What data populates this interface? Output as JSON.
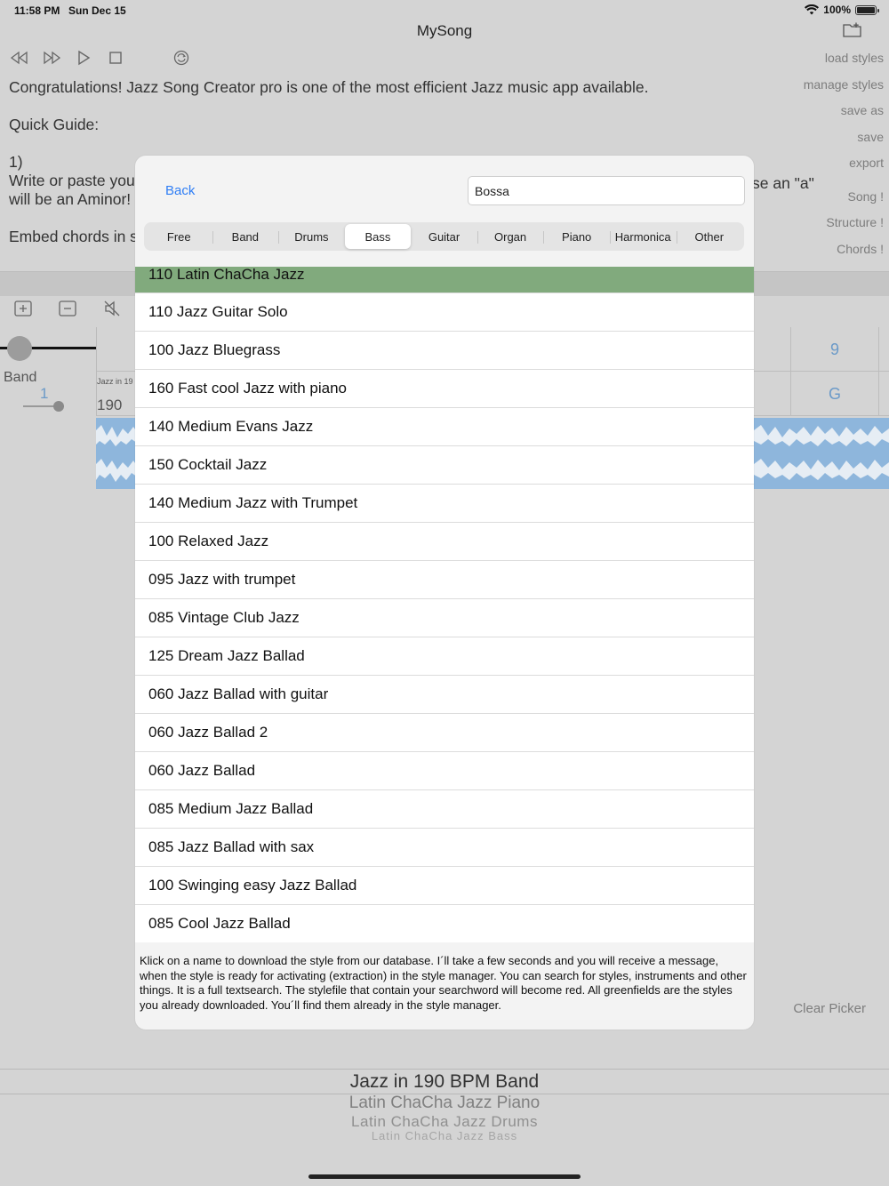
{
  "status": {
    "time": "11:58 PM",
    "date": "Sun Dec 15",
    "battery": "100%"
  },
  "app": {
    "title": "MySong"
  },
  "side_menu": [
    "load styles",
    "manage styles",
    "save as",
    "save",
    "export",
    "Song !",
    "Structure !",
    "Chords !"
  ],
  "guide": {
    "line1": "Congratulations! Jazz Song Creator pro is one of the most efficient Jazz music app available.",
    "line2": "Quick Guide:",
    "line3": "1)",
    "line4": "Write or paste you",
    "line4_right": "se an \"a\"",
    "line5": "will be an Aminor!",
    "line6": "Embed chords in s"
  },
  "track": {
    "label": "Band",
    "number": "1",
    "style_label": "Jazz in 19",
    "tempo": "190",
    "bar": "9",
    "chord": "G"
  },
  "clear_picker": "Clear Picker",
  "picker_items": [
    "Jazz in 190 BPM Band",
    "Latin ChaCha Jazz Piano",
    "Latin ChaCha Jazz Drums",
    "Latin ChaCha Jazz Bass"
  ],
  "modal": {
    "back": "Back",
    "search_value": "Bossa",
    "tabs": [
      "Free",
      "Band",
      "Drums",
      "Bass",
      "Guitar",
      "Organ",
      "Piano",
      "Harmonica",
      "Other"
    ],
    "active_tab": "Bass",
    "items": [
      "110 Latin ChaCha Jazz",
      "110 Jazz Guitar Solo",
      "100 Jazz Bluegrass",
      "160 Fast cool Jazz with piano",
      "140 Medium Evans Jazz",
      "150 Cocktail Jazz",
      "140 Medium Jazz with Trumpet",
      "100 Relaxed Jazz",
      "095 Jazz with trumpet",
      "085 Vintage Club Jazz",
      "125 Dream Jazz Ballad",
      "060 Jazz Ballad with guitar",
      "060 Jazz Ballad 2",
      "060 Jazz Ballad",
      "085 Medium Jazz Ballad",
      "085 Jazz Ballad with sax",
      "100 Swinging easy Jazz Ballad",
      "085 Cool Jazz Ballad"
    ],
    "downloaded_item": "110 Latin ChaCha Jazz",
    "footer": "Klick on a name to download the style from our database.  I´ll take a few seconds and you will receive a message, when the style is ready for activating (extraction) in the style manager. You can search for styles, instruments and other things. It is a full textsearch. The stylefile that contain your searchword will become red. All greenfields are the styles you already downloaded. You´ll find them already in the style manager."
  },
  "colors": {
    "accent": "#2f7ef5",
    "downloaded": "#81aa7d",
    "wave": "#8eb6dc"
  }
}
